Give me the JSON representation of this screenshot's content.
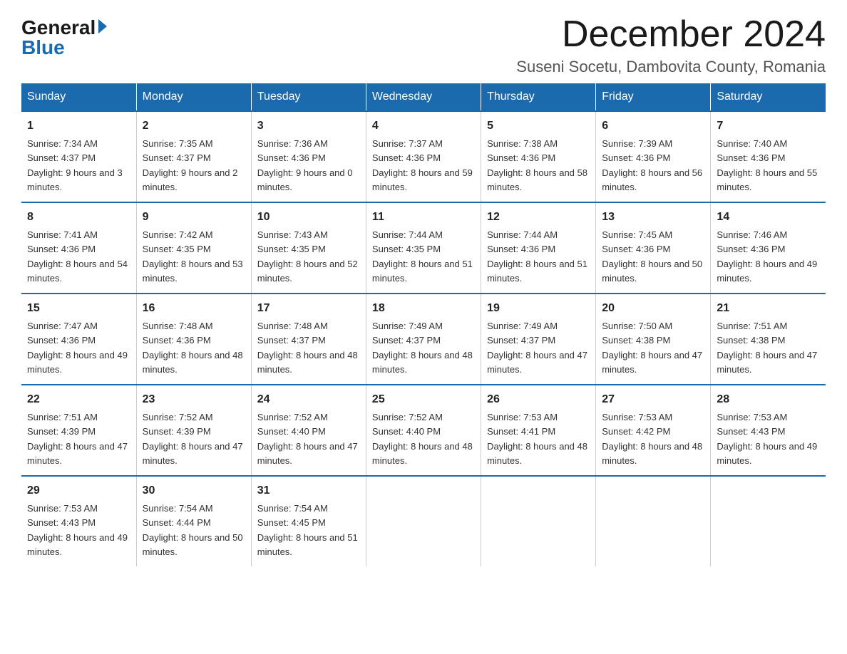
{
  "logo": {
    "general": "General",
    "blue": "Blue"
  },
  "title": {
    "month_year": "December 2024",
    "location": "Suseni Socetu, Dambovita County, Romania"
  },
  "header_days": [
    "Sunday",
    "Monday",
    "Tuesday",
    "Wednesday",
    "Thursday",
    "Friday",
    "Saturday"
  ],
  "weeks": [
    [
      {
        "day": "1",
        "sunrise": "7:34 AM",
        "sunset": "4:37 PM",
        "daylight": "9 hours and 3 minutes."
      },
      {
        "day": "2",
        "sunrise": "7:35 AM",
        "sunset": "4:37 PM",
        "daylight": "9 hours and 2 minutes."
      },
      {
        "day": "3",
        "sunrise": "7:36 AM",
        "sunset": "4:36 PM",
        "daylight": "9 hours and 0 minutes."
      },
      {
        "day": "4",
        "sunrise": "7:37 AM",
        "sunset": "4:36 PM",
        "daylight": "8 hours and 59 minutes."
      },
      {
        "day": "5",
        "sunrise": "7:38 AM",
        "sunset": "4:36 PM",
        "daylight": "8 hours and 58 minutes."
      },
      {
        "day": "6",
        "sunrise": "7:39 AM",
        "sunset": "4:36 PM",
        "daylight": "8 hours and 56 minutes."
      },
      {
        "day": "7",
        "sunrise": "7:40 AM",
        "sunset": "4:36 PM",
        "daylight": "8 hours and 55 minutes."
      }
    ],
    [
      {
        "day": "8",
        "sunrise": "7:41 AM",
        "sunset": "4:36 PM",
        "daylight": "8 hours and 54 minutes."
      },
      {
        "day": "9",
        "sunrise": "7:42 AM",
        "sunset": "4:35 PM",
        "daylight": "8 hours and 53 minutes."
      },
      {
        "day": "10",
        "sunrise": "7:43 AM",
        "sunset": "4:35 PM",
        "daylight": "8 hours and 52 minutes."
      },
      {
        "day": "11",
        "sunrise": "7:44 AM",
        "sunset": "4:35 PM",
        "daylight": "8 hours and 51 minutes."
      },
      {
        "day": "12",
        "sunrise": "7:44 AM",
        "sunset": "4:36 PM",
        "daylight": "8 hours and 51 minutes."
      },
      {
        "day": "13",
        "sunrise": "7:45 AM",
        "sunset": "4:36 PM",
        "daylight": "8 hours and 50 minutes."
      },
      {
        "day": "14",
        "sunrise": "7:46 AM",
        "sunset": "4:36 PM",
        "daylight": "8 hours and 49 minutes."
      }
    ],
    [
      {
        "day": "15",
        "sunrise": "7:47 AM",
        "sunset": "4:36 PM",
        "daylight": "8 hours and 49 minutes."
      },
      {
        "day": "16",
        "sunrise": "7:48 AM",
        "sunset": "4:36 PM",
        "daylight": "8 hours and 48 minutes."
      },
      {
        "day": "17",
        "sunrise": "7:48 AM",
        "sunset": "4:37 PM",
        "daylight": "8 hours and 48 minutes."
      },
      {
        "day": "18",
        "sunrise": "7:49 AM",
        "sunset": "4:37 PM",
        "daylight": "8 hours and 48 minutes."
      },
      {
        "day": "19",
        "sunrise": "7:49 AM",
        "sunset": "4:37 PM",
        "daylight": "8 hours and 47 minutes."
      },
      {
        "day": "20",
        "sunrise": "7:50 AM",
        "sunset": "4:38 PM",
        "daylight": "8 hours and 47 minutes."
      },
      {
        "day": "21",
        "sunrise": "7:51 AM",
        "sunset": "4:38 PM",
        "daylight": "8 hours and 47 minutes."
      }
    ],
    [
      {
        "day": "22",
        "sunrise": "7:51 AM",
        "sunset": "4:39 PM",
        "daylight": "8 hours and 47 minutes."
      },
      {
        "day": "23",
        "sunrise": "7:52 AM",
        "sunset": "4:39 PM",
        "daylight": "8 hours and 47 minutes."
      },
      {
        "day": "24",
        "sunrise": "7:52 AM",
        "sunset": "4:40 PM",
        "daylight": "8 hours and 47 minutes."
      },
      {
        "day": "25",
        "sunrise": "7:52 AM",
        "sunset": "4:40 PM",
        "daylight": "8 hours and 48 minutes."
      },
      {
        "day": "26",
        "sunrise": "7:53 AM",
        "sunset": "4:41 PM",
        "daylight": "8 hours and 48 minutes."
      },
      {
        "day": "27",
        "sunrise": "7:53 AM",
        "sunset": "4:42 PM",
        "daylight": "8 hours and 48 minutes."
      },
      {
        "day": "28",
        "sunrise": "7:53 AM",
        "sunset": "4:43 PM",
        "daylight": "8 hours and 49 minutes."
      }
    ],
    [
      {
        "day": "29",
        "sunrise": "7:53 AM",
        "sunset": "4:43 PM",
        "daylight": "8 hours and 49 minutes."
      },
      {
        "day": "30",
        "sunrise": "7:54 AM",
        "sunset": "4:44 PM",
        "daylight": "8 hours and 50 minutes."
      },
      {
        "day": "31",
        "sunrise": "7:54 AM",
        "sunset": "4:45 PM",
        "daylight": "8 hours and 51 minutes."
      },
      null,
      null,
      null,
      null
    ]
  ]
}
